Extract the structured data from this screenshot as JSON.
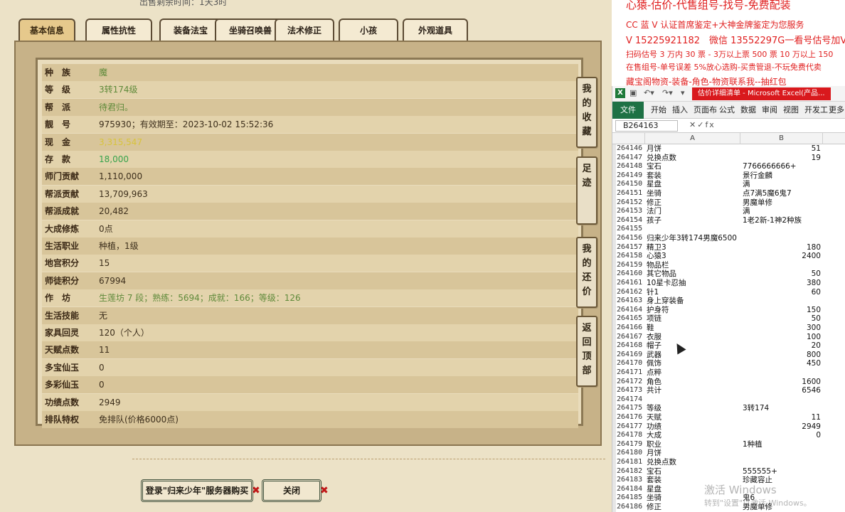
{
  "game": {
    "top_note": "出售剩余时间：1天3时",
    "tabs": [
      "基本信息",
      "属性抗性",
      "装备法宝",
      "坐骑召唤兽",
      "法术修正",
      "小孩",
      "外观道具"
    ],
    "active_tab": 0,
    "rows": [
      {
        "label": "种　族",
        "value": "魔",
        "style": "green"
      },
      {
        "label": "等　级",
        "value": "3转174级",
        "style": "green"
      },
      {
        "label": "帮　派",
        "value": "待君归。",
        "style": "green"
      },
      {
        "label": "靓　号",
        "value": "975930；有效期至：2023-10-02 15:52:36",
        "style": "dark"
      },
      {
        "label": "现　金",
        "value": "3,315,547",
        "style": "yellow"
      },
      {
        "label": "存　款",
        "value": "18,000",
        "style": "bright"
      },
      {
        "label": "师门贡献",
        "value": "1,110,000",
        "style": "dark"
      },
      {
        "label": "帮派贡献",
        "value": "13,709,963",
        "style": "dark"
      },
      {
        "label": "帮派成就",
        "value": "20,482",
        "style": "dark"
      },
      {
        "label": "大成修炼",
        "value": "0点",
        "style": "dark"
      },
      {
        "label": "生活职业",
        "value": "种植，1级",
        "style": "dark"
      },
      {
        "label": "地宫积分",
        "value": "15",
        "style": "dark"
      },
      {
        "label": "师徒积分",
        "value": "67994",
        "style": "dark"
      },
      {
        "label": "作　坊",
        "value": "生莲坊 7 段；熟练：5694；成就：166；等级：126",
        "style": "green"
      },
      {
        "label": "生活技能",
        "value": "无",
        "style": "dark"
      },
      {
        "label": "家具回灵",
        "value": "120（个人）",
        "style": "dark"
      },
      {
        "label": "天赋点数",
        "value": "11",
        "style": "dark"
      },
      {
        "label": "多宝仙玉",
        "value": "0",
        "style": "dark"
      },
      {
        "label": "多彩仙玉",
        "value": "0",
        "style": "dark"
      },
      {
        "label": "功绩点数",
        "value": "2949",
        "style": "dark"
      },
      {
        "label": "排队特权",
        "value": "免排队(价格6000点)",
        "style": "dark"
      }
    ],
    "side_buttons": [
      "我的收藏",
      "足迹",
      "我的还价",
      "返回顶部"
    ],
    "login_button": "登录\"归来少年\"服务器购买",
    "close_button": "关闭",
    "x_mark": "✖"
  },
  "overlay": {
    "line1": "心猿-估价-代售组号-找号-免费配装",
    "line2": "CC 蓝 V 认证首席鉴定+大神金牌鉴定为您服务",
    "line3": "V 15225921182　微信 13552297G一看号估号加V",
    "line4": "扫码估号 3 万内 30 票 - 3万以上票 500 票 10 万以上 150",
    "line5": "在售组号-单号误差 5%放心选购-买贵管退-不玩免费代卖",
    "line6": "藏宝阁物资-装备-角色-物资联系我--抽红包"
  },
  "excel": {
    "doc_title": "估价详细清单 - Microsoft Excel(产品...",
    "ribbon_tabs": [
      "文件",
      "开始",
      "插入",
      "页面布",
      "公式",
      "数据",
      "审阅",
      "视图",
      "开发工",
      "更多"
    ],
    "name_box": "B264163",
    "fx": "fx",
    "col_a": "A",
    "col_b": "B",
    "rows": [
      {
        "n": "264146",
        "a": "月饼",
        "b": "51",
        "num": true
      },
      {
        "n": "264147",
        "a": "兑换点数",
        "b": "19",
        "num": true
      },
      {
        "n": "264148",
        "a": "宝石",
        "b": "7766666666+",
        "num": false
      },
      {
        "n": "264149",
        "a": "套装",
        "b": "景行金麟",
        "num": false
      },
      {
        "n": "264150",
        "a": "星盘",
        "b": "满",
        "num": false
      },
      {
        "n": "264151",
        "a": "坐骑",
        "b": "点7满5魔6鬼7",
        "num": false
      },
      {
        "n": "264152",
        "a": "修正",
        "b": "男魔单修",
        "num": false
      },
      {
        "n": "264153",
        "a": "法门",
        "b": "满",
        "num": false
      },
      {
        "n": "264154",
        "a": "孩子",
        "b": "1老2新-1神2种族",
        "num": false
      },
      {
        "n": "264155",
        "a": "",
        "b": "",
        "num": false
      },
      {
        "n": "264156",
        "a": "归来少年3转174男魔6500",
        "b": "",
        "num": false
      },
      {
        "n": "264157",
        "a": "精卫3",
        "b": "180",
        "num": true
      },
      {
        "n": "264158",
        "a": "心猿3",
        "b": "2400",
        "num": true
      },
      {
        "n": "264159",
        "a": "物品栏",
        "b": "",
        "num": false
      },
      {
        "n": "264160",
        "a": "其它物品",
        "b": "50",
        "num": true
      },
      {
        "n": "264161",
        "a": "10星卡忍抽",
        "b": "380",
        "num": true
      },
      {
        "n": "264162",
        "a": "针1",
        "b": "60",
        "num": true
      },
      {
        "n": "264163",
        "a": "身上穿装备",
        "b": "",
        "num": false
      },
      {
        "n": "264164",
        "a": "护身符",
        "b": "150",
        "num": true
      },
      {
        "n": "264165",
        "a": "项链",
        "b": "50",
        "num": true
      },
      {
        "n": "264166",
        "a": "鞋",
        "b": "300",
        "num": true
      },
      {
        "n": "264167",
        "a": "衣服",
        "b": "100",
        "num": true
      },
      {
        "n": "264168",
        "a": "帽子",
        "b": "20",
        "num": true
      },
      {
        "n": "264169",
        "a": "武器",
        "b": "800",
        "num": true
      },
      {
        "n": "264170",
        "a": "佩饰",
        "b": "450",
        "num": true
      },
      {
        "n": "264171",
        "a": "点粹",
        "b": "",
        "num": false
      },
      {
        "n": "264172",
        "a": "角色",
        "b": "1600",
        "num": true
      },
      {
        "n": "264173",
        "a": "共计",
        "b": "6546",
        "num": true
      },
      {
        "n": "264174",
        "a": "",
        "b": "",
        "num": false
      },
      {
        "n": "264175",
        "a": "等级",
        "b": "3转174",
        "num": false
      },
      {
        "n": "264176",
        "a": "天赋",
        "b": "11",
        "num": true
      },
      {
        "n": "264177",
        "a": "功绩",
        "b": "2949",
        "num": true
      },
      {
        "n": "264178",
        "a": "大成",
        "b": "0",
        "num": true
      },
      {
        "n": "264179",
        "a": "职业",
        "b": "1种植",
        "num": false
      },
      {
        "n": "264180",
        "a": "月饼",
        "b": "",
        "num": false
      },
      {
        "n": "264181",
        "a": "兑换点数",
        "b": "",
        "num": false
      },
      {
        "n": "264182",
        "a": "宝石",
        "b": "555555+",
        "num": false
      },
      {
        "n": "264183",
        "a": "套装",
        "b": "珍藏容止",
        "num": false
      },
      {
        "n": "264184",
        "a": "星盘",
        "b": "",
        "num": false
      },
      {
        "n": "264185",
        "a": "坐骑",
        "b": "鬼6",
        "num": false
      },
      {
        "n": "264186",
        "a": "修正",
        "b": "男魔单修",
        "num": false
      }
    ]
  },
  "watermark": {
    "line1": "激活 Windows",
    "line2": "转到\"设置\"以激活 Windows。"
  }
}
